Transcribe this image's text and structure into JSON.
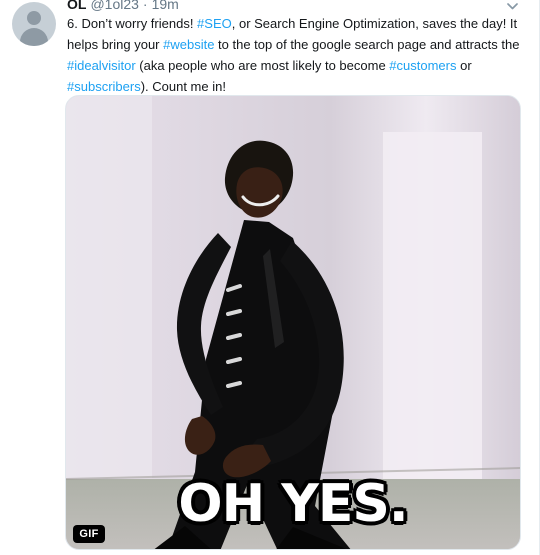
{
  "tweet": {
    "author": {
      "display_name": "OL",
      "handle": "@1ol23",
      "separator": "·",
      "time": "19m",
      "avatar_icon": "default-user-avatar-icon"
    },
    "menu_icon": "chevron-down-icon",
    "text_segments": [
      {
        "text": "6. Don’t worry friends! ",
        "link": false
      },
      {
        "text": "#SEO",
        "link": true
      },
      {
        "text": ", or Search Engine Optimization, saves the day! It helps bring your ",
        "link": false
      },
      {
        "text": "#website",
        "link": true
      },
      {
        "text": " to the top of the google search page and attracts the ",
        "link": false
      },
      {
        "text": "#idealvisitor",
        "link": true
      },
      {
        "text": " (aka people who are most likely to become ",
        "link": false
      },
      {
        "text": "#customers",
        "link": true
      },
      {
        "text": " or ",
        "link": false
      },
      {
        "text": "#subscribers",
        "link": true
      },
      {
        "text": "). Count me in!",
        "link": false
      }
    ],
    "media": {
      "type": "GIF",
      "caption": "OH YES.",
      "badge": "GIF"
    }
  },
  "colors": {
    "link": "#1da1f2",
    "text": "#14171a",
    "muted": "#657786",
    "divider": "#e6ecf0",
    "gif_badge_bg": "#000000"
  }
}
